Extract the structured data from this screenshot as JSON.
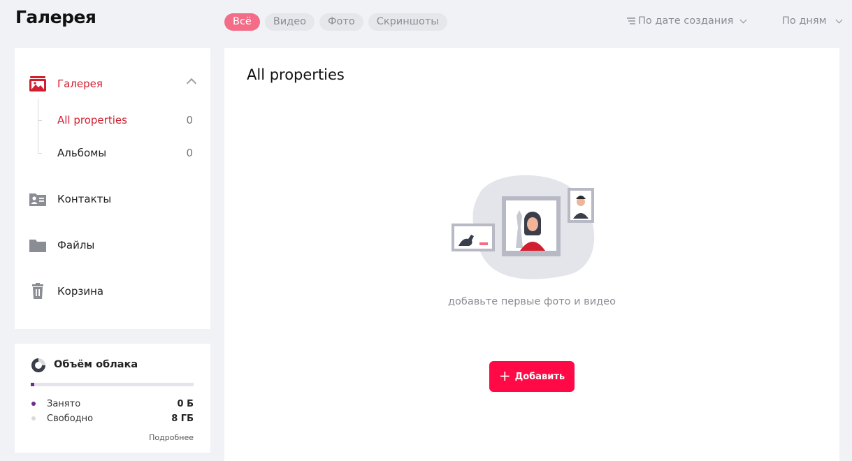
{
  "header": {
    "title": "Галерея"
  },
  "filters": [
    {
      "label": "Всё",
      "active": true
    },
    {
      "label": "Видео",
      "active": false
    },
    {
      "label": "Фото",
      "active": false
    },
    {
      "label": "Скриншоты",
      "active": false
    }
  ],
  "sort": {
    "label": "По дате создания",
    "icon": "sort-lines-icon"
  },
  "grouping": {
    "label": "По дням"
  },
  "sidebar": {
    "gallery": {
      "label": "Галерея",
      "icon": "gallery-icon"
    },
    "sub_items": [
      {
        "label": "All properties",
        "count": "0"
      },
      {
        "label": "Альбомы",
        "count": "0"
      }
    ],
    "contacts": {
      "label": "Контакты",
      "icon": "contacts-icon"
    },
    "files": {
      "label": "Файлы",
      "icon": "folder-icon"
    },
    "trash": {
      "label": "Корзина",
      "icon": "trash-icon"
    }
  },
  "storage": {
    "title": "Объём облака",
    "used_label": "Занято",
    "used_value": "0 Б",
    "free_label": "Свободно",
    "free_value": "8 ГБ",
    "used_fraction": 0.02,
    "more_label": "Подробнее",
    "used_color": "#6d2c8a",
    "free_color": "#e3e5ea"
  },
  "main": {
    "title": "All properties",
    "empty_text": "добавьте первые фото и видео",
    "add_label": "Добавить"
  },
  "colors": {
    "accent": "#ff0a46",
    "active_text": "#d11f2f",
    "chip_active": "#f36d88"
  }
}
